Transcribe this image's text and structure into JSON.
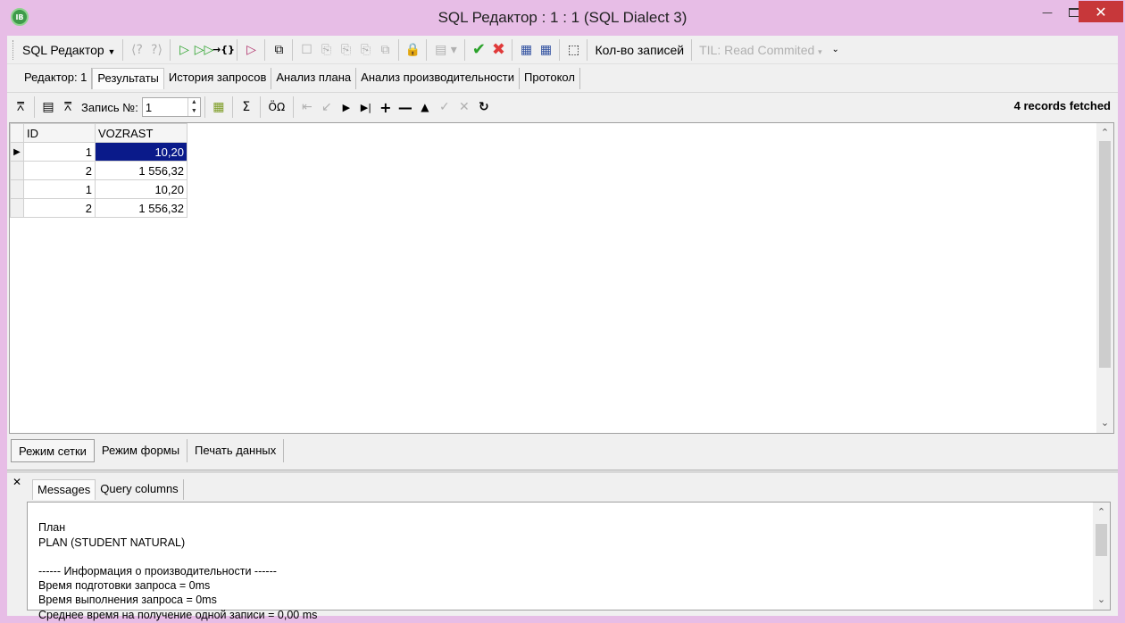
{
  "window": {
    "title": "SQL Редактор : 1 : 1 (SQL Dialect 3)",
    "app_icon_text": "IB"
  },
  "toolbar1": {
    "editor_dropdown": "SQL Редактор",
    "record_count_label": "Кол-во записей",
    "til_label": "TIL: Read Commited"
  },
  "tabs": [
    {
      "label": "Редактор: 1"
    },
    {
      "label": "Результаты"
    },
    {
      "label": "История запросов"
    },
    {
      "label": "Анализ плана"
    },
    {
      "label": "Анализ производительности"
    },
    {
      "label": "Протокол"
    }
  ],
  "toolbar2": {
    "record_no_label": "Запись №:",
    "record_no_value": "1",
    "status": "4 records fetched"
  },
  "grid": {
    "columns": [
      "ID",
      "VOZRAST"
    ],
    "rows": [
      {
        "id": "1",
        "vozrast": "10,20"
      },
      {
        "id": "2",
        "vozrast": "1 556,32"
      },
      {
        "id": "1",
        "vozrast": "10,20"
      },
      {
        "id": "2",
        "vozrast": "1 556,32"
      }
    ]
  },
  "mode_tabs": [
    {
      "label": "Режим сетки"
    },
    {
      "label": "Режим формы"
    },
    {
      "label": "Печать данных"
    }
  ],
  "messages": {
    "tabs": [
      {
        "label": "Messages"
      },
      {
        "label": "Query columns"
      }
    ],
    "lines": [
      "План",
      "PLAN (STUDENT NATURAL)",
      "",
      "------ Информация о производительности ------",
      "Время подготовки запроса = 0ms",
      "Время выполнения запроса = 0ms",
      "Среднее время на получение одной записи = 0,00 ms"
    ]
  },
  "colors": {
    "title_bar": "#e7bde6",
    "selection": "#0a1a8a",
    "close_button": "#c7373a"
  }
}
